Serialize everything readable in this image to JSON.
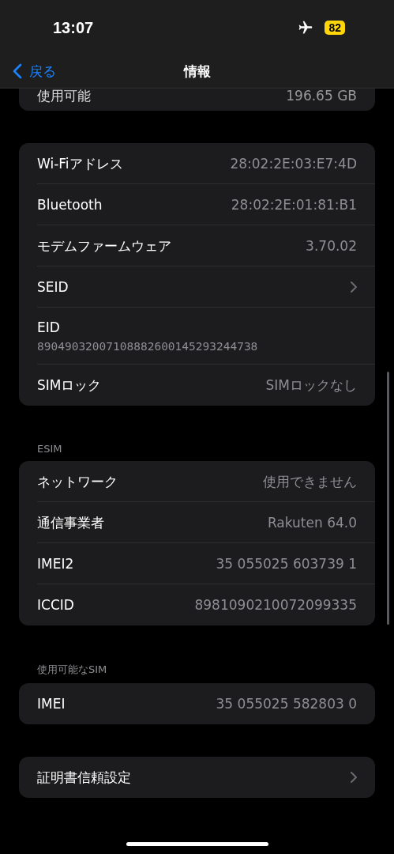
{
  "status_bar": {
    "time": "13:07",
    "airplane_mode": true,
    "battery": "82"
  },
  "nav": {
    "back": "戻る",
    "title": "情報"
  },
  "sections": [
    {
      "rows": [
        {
          "kind": "value",
          "label": "使用可能",
          "value": "196.65 GB"
        }
      ],
      "partial": true
    },
    {
      "rows": [
        {
          "kind": "value",
          "label": "Wi-Fiアドレス",
          "value": "28:02:2E:03:E7:4D"
        },
        {
          "kind": "value",
          "label": "Bluetooth",
          "value": "28:02:2E:01:81:B1"
        },
        {
          "kind": "value",
          "label": "モデムファームウェア",
          "value": "3.70.02"
        },
        {
          "kind": "chevron",
          "label": "SEID"
        },
        {
          "kind": "stacked",
          "label": "EID",
          "value": "89049032007108882600145293244738"
        },
        {
          "kind": "value",
          "label": "SIMロック",
          "value": "SIMロックなし"
        }
      ]
    },
    {
      "header": "ESIM",
      "rows": [
        {
          "kind": "value",
          "label": "ネットワーク",
          "value": "使用できません"
        },
        {
          "kind": "value",
          "label": "通信事業者",
          "value": "Rakuten 64.0"
        },
        {
          "kind": "value",
          "label": "IMEI2",
          "value": "35 055025 603739 1"
        },
        {
          "kind": "value",
          "label": "ICCID",
          "value": "8981090210072099335"
        }
      ]
    },
    {
      "header": "使用可能なSIM",
      "rows": [
        {
          "kind": "value",
          "label": "IMEI",
          "value": "35 055025 582803 0"
        }
      ]
    },
    {
      "rows": [
        {
          "kind": "chevron",
          "label": "証明書信頼設定"
        }
      ]
    }
  ]
}
